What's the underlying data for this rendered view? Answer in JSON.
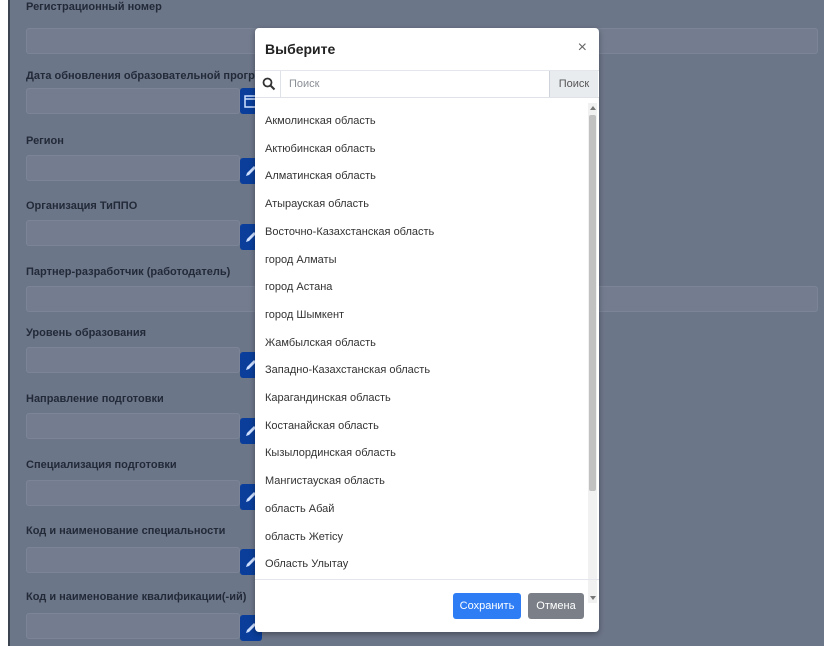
{
  "form": {
    "fields": [
      {
        "label": "Регистрационный номер"
      },
      {
        "label": "Дата обновления образовательной программы"
      },
      {
        "label": "Регион"
      },
      {
        "label": "Организация ТиППО"
      },
      {
        "label": "Партнер-разработчик (работодатель)"
      },
      {
        "label": "Уровень образования"
      },
      {
        "label": "Направление подготовки"
      },
      {
        "label": "Специализация подготовки"
      },
      {
        "label": "Код и наименование специальности"
      },
      {
        "label": "Код и наименование квалификации(-ий)"
      }
    ]
  },
  "modal": {
    "title": "Выберите",
    "close_symbol": "×",
    "search": {
      "placeholder": "Поиск",
      "value": "",
      "button_label": "Поиск",
      "icon": "search-icon"
    },
    "items": [
      "Акмолинская область",
      "Актюбинская область",
      "Алматинская область",
      "Атырауская область",
      "Восточно-Казахстанская область",
      "город Алматы",
      "город Астана",
      "город Шымкент",
      "Жамбылская область",
      "Западно-Казахстанская область",
      "Карагандинская область",
      "Костанайская область",
      "Кызылординская область",
      "Мангистауская область",
      "область Абай",
      "область Жетісу",
      "Область Улытау"
    ],
    "save_label": "Сохранить",
    "cancel_label": "Отмена"
  },
  "colors": {
    "overlay": "#6c7689",
    "accent": "#2e7df5",
    "secondary": "#7b8088",
    "field_button": "#0a3e9a"
  }
}
